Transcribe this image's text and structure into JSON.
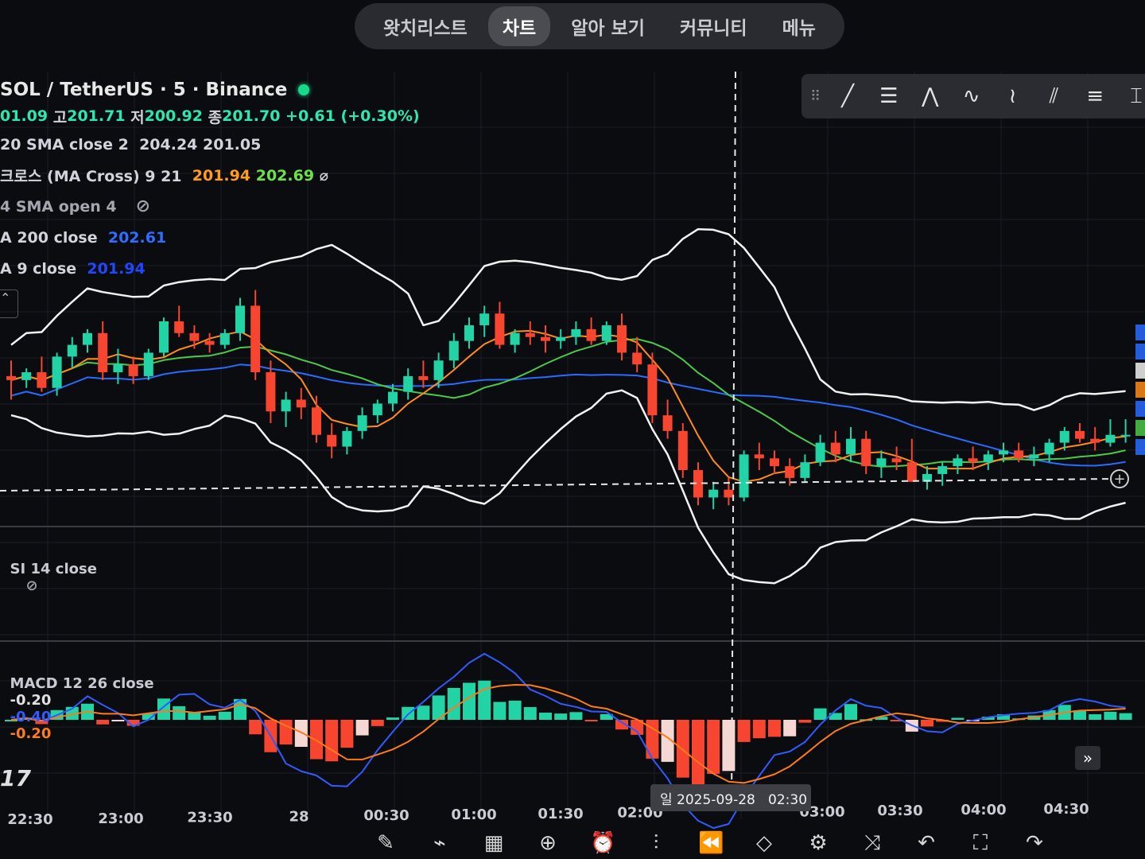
{
  "nav": {
    "tabs": [
      {
        "label": "왓치리스트",
        "active": false
      },
      {
        "label": "차트",
        "active": true
      },
      {
        "label": "알아 보기",
        "active": false
      },
      {
        "label": "커뮤니티",
        "active": false
      },
      {
        "label": "메뉴",
        "active": false
      }
    ]
  },
  "legend": {
    "symbol": "SOL / TetherUS · 5 · Binance",
    "ohlc": {
      "o": "01.09",
      "h_label": "고",
      "h": "201.71",
      "l_label": "저",
      "l": "200.92",
      "c_label": "종",
      "c": "201.70",
      "change": "+0.61 (+0.30%)"
    },
    "sma20": {
      "label": "20 SMA close 2",
      "v1": "204.24",
      "v2": "201.05"
    },
    "macross": {
      "label": "크로스 (MA Cross) 9 21",
      "v1": "201.94",
      "v2": "202.69",
      "suffix": "⌀"
    },
    "sma4": {
      "label": "4 SMA open 4"
    },
    "ma200": {
      "label": "A 200 close",
      "value": "202.61"
    },
    "ma9": {
      "label": "A 9 close",
      "value": "201.94"
    }
  },
  "rsi": {
    "label": "SI 14 close"
  },
  "macd": {
    "label": "MACD 12 26 close",
    "v1": "-0.20",
    "v2": "-0.40",
    "v3": "-0.20"
  },
  "crosshair_tooltip": "일 2025-09-28   02:30",
  "colors": {
    "up": "#22d3a6",
    "down": "#f7452f",
    "bb": "#f2f2f2",
    "sma_orange": "#ff8c1a",
    "ma_green": "#4cc94a",
    "ma200_blue": "#2a6bff",
    "macd_line": "#2f5bff",
    "signal_line": "#ff7a1a",
    "hist_up": "#22d3a6",
    "hist_down": "#f7452f",
    "hist_light": "#f5d8d4"
  },
  "drawing_tools": [
    "trend-line-icon",
    "horizontal-lines-icon",
    "pattern-icon",
    "elliott-wave-icon",
    "abcd-icon",
    "parallel-channel-icon",
    "fib-icon",
    "more-icon"
  ],
  "bottom_tools": [
    "brush-icon",
    "indicator-icon",
    "layout-icon",
    "add-icon",
    "alarm-icon",
    "candle-type-icon",
    "replay-icon",
    "layers-icon",
    "settings-icon",
    "compare-icon",
    "undo-icon",
    "fullscreen-icon",
    "redo-icon",
    "idea-icon"
  ],
  "chart_data": {
    "type": "line",
    "title": "SOL / TetherUS · 5 · Binance",
    "x_tick_labels": [
      "22:30",
      "23:00",
      "23:30",
      "28",
      "00:30",
      "01:00",
      "01:30",
      "02:00",
      "03:00",
      "03:30",
      "04:00",
      "04:30"
    ],
    "candles_approx": [
      [
        203.2,
        203.6,
        202.6,
        203.1
      ],
      [
        203.1,
        203.4,
        202.9,
        203.3
      ],
      [
        203.3,
        203.7,
        202.8,
        202.9
      ],
      [
        202.9,
        203.8,
        202.7,
        203.7
      ],
      [
        203.7,
        204.2,
        203.4,
        204.0
      ],
      [
        204.0,
        204.4,
        203.8,
        204.3
      ],
      [
        204.3,
        204.6,
        203.1,
        203.3
      ],
      [
        203.3,
        203.9,
        203.0,
        203.5
      ],
      [
        203.5,
        203.7,
        203.0,
        203.2
      ],
      [
        203.2,
        203.9,
        203.1,
        203.8
      ],
      [
        203.8,
        204.7,
        203.7,
        204.6
      ],
      [
        204.6,
        205.0,
        204.2,
        204.3
      ],
      [
        204.3,
        204.5,
        203.9,
        204.1
      ],
      [
        204.1,
        204.3,
        203.8,
        204.0
      ],
      [
        204.0,
        204.4,
        203.9,
        204.3
      ],
      [
        204.3,
        205.2,
        204.1,
        205.0
      ],
      [
        205.0,
        205.4,
        203.1,
        203.3
      ],
      [
        203.3,
        203.6,
        202.0,
        202.3
      ],
      [
        202.3,
        202.8,
        201.9,
        202.6
      ],
      [
        202.6,
        202.9,
        202.1,
        202.4
      ],
      [
        202.4,
        202.7,
        201.5,
        201.7
      ],
      [
        201.7,
        202.0,
        201.1,
        201.4
      ],
      [
        201.4,
        201.9,
        201.2,
        201.8
      ],
      [
        201.8,
        202.4,
        201.6,
        202.2
      ],
      [
        202.2,
        202.6,
        202.0,
        202.5
      ],
      [
        202.5,
        203.0,
        202.3,
        202.8
      ],
      [
        202.8,
        203.4,
        202.6,
        203.2
      ],
      [
        203.2,
        203.6,
        202.9,
        203.1
      ],
      [
        203.1,
        203.8,
        202.9,
        203.6
      ],
      [
        203.6,
        204.3,
        203.4,
        204.1
      ],
      [
        204.1,
        204.7,
        203.9,
        204.5
      ],
      [
        204.5,
        205.0,
        204.2,
        204.8
      ],
      [
        204.8,
        205.1,
        203.9,
        204.0
      ],
      [
        204.0,
        204.4,
        203.8,
        204.3
      ],
      [
        204.3,
        204.6,
        204.0,
        204.2
      ],
      [
        204.2,
        204.5,
        203.8,
        204.1
      ],
      [
        204.1,
        204.4,
        203.9,
        204.2
      ],
      [
        204.2,
        204.6,
        204.0,
        204.4
      ],
      [
        204.4,
        204.7,
        204.0,
        204.1
      ],
      [
        204.1,
        204.6,
        204.0,
        204.5
      ],
      [
        204.5,
        204.8,
        203.6,
        203.8
      ],
      [
        203.8,
        204.2,
        203.3,
        203.5
      ],
      [
        203.5,
        203.8,
        202.0,
        202.2
      ],
      [
        202.2,
        202.6,
        201.6,
        201.8
      ],
      [
        201.8,
        202.0,
        200.6,
        200.8
      ],
      [
        200.8,
        201.0,
        199.9,
        200.1
      ],
      [
        200.1,
        200.5,
        199.8,
        200.3
      ],
      [
        200.3,
        200.6,
        199.9,
        200.1
      ],
      [
        200.1,
        201.3,
        200.0,
        201.2
      ],
      [
        201.2,
        201.5,
        200.8,
        201.1
      ],
      [
        201.1,
        201.3,
        200.7,
        200.9
      ],
      [
        200.9,
        201.1,
        200.4,
        200.6
      ],
      [
        200.6,
        201.2,
        200.5,
        201.0
      ],
      [
        201.0,
        201.7,
        200.9,
        201.5
      ],
      [
        201.5,
        201.8,
        201.0,
        201.2
      ],
      [
        201.2,
        201.9,
        201.0,
        201.6
      ],
      [
        201.6,
        201.8,
        200.7,
        200.9
      ],
      [
        200.9,
        201.3,
        200.6,
        201.1
      ],
      [
        201.1,
        201.4,
        200.8,
        201.0
      ],
      [
        201.0,
        201.6,
        200.6,
        200.5
      ],
      [
        200.5,
        200.9,
        200.3,
        200.7
      ],
      [
        200.7,
        201.0,
        200.4,
        200.9
      ],
      [
        200.9,
        201.2,
        200.7,
        201.1
      ],
      [
        201.1,
        201.4,
        200.8,
        201.0
      ],
      [
        201.0,
        201.3,
        200.8,
        201.2
      ],
      [
        201.2,
        201.5,
        201.0,
        201.3
      ],
      [
        201.3,
        201.5,
        201.0,
        201.1
      ],
      [
        201.1,
        201.4,
        200.9,
        201.2
      ],
      [
        201.2,
        201.6,
        201.0,
        201.5
      ],
      [
        201.5,
        201.9,
        201.3,
        201.8
      ],
      [
        201.8,
        202.0,
        201.5,
        201.6
      ],
      [
        201.6,
        201.9,
        201.3,
        201.5
      ],
      [
        201.5,
        202.1,
        201.4,
        201.7
      ],
      [
        201.7,
        202.1,
        201.5,
        201.7
      ]
    ],
    "series": [
      {
        "name": "20 SMA close 2",
        "color": "#ff8c1a"
      },
      {
        "name": "MA Cross 9 21 (slow)",
        "color": "#4cc94a"
      },
      {
        "name": "A 200 close",
        "color": "#2a6bff"
      },
      {
        "name": "Bollinger Bands",
        "color": "#f2f2f2"
      }
    ],
    "last_values": {
      "sma20": [
        204.24,
        201.05
      ],
      "macross": [
        201.94,
        202.69
      ],
      "ma200": 202.61,
      "ma9": 201.94
    },
    "macd": {
      "macd": -0.4,
      "signal": -0.2,
      "hist": -0.2
    },
    "ylim": [
      199.5,
      205.8
    ]
  }
}
